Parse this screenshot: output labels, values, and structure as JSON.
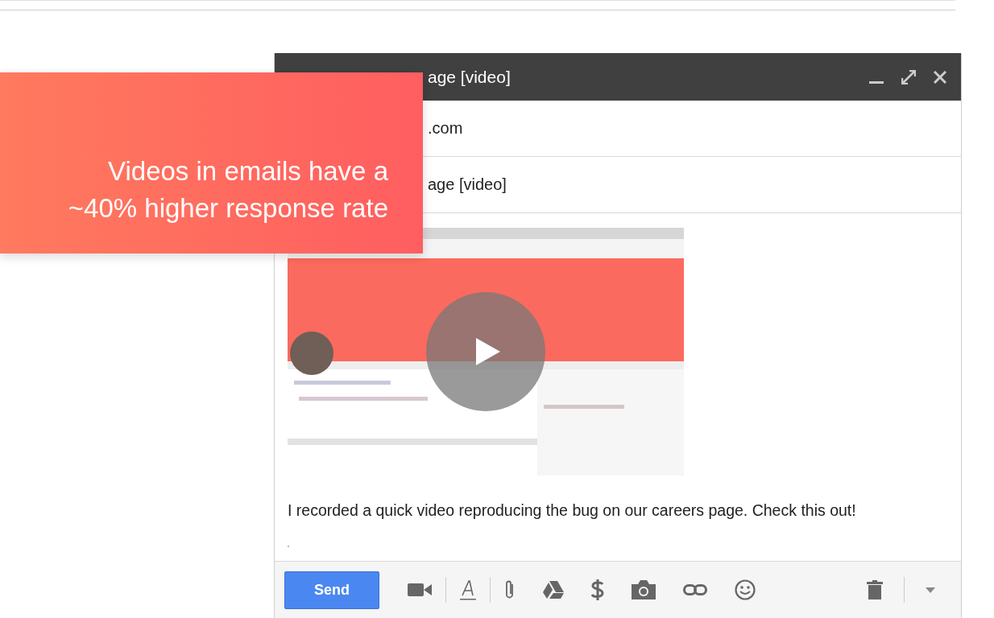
{
  "compose": {
    "title": "age [video]",
    "to": ".com",
    "subject": "age [video]",
    "message": "I recorded a quick video reproducing the bug on our careers page. Check this out!",
    "send": "Send"
  },
  "promo": {
    "lines": [
      "Videos in emails have a",
      "~40% higher response rate"
    ]
  }
}
